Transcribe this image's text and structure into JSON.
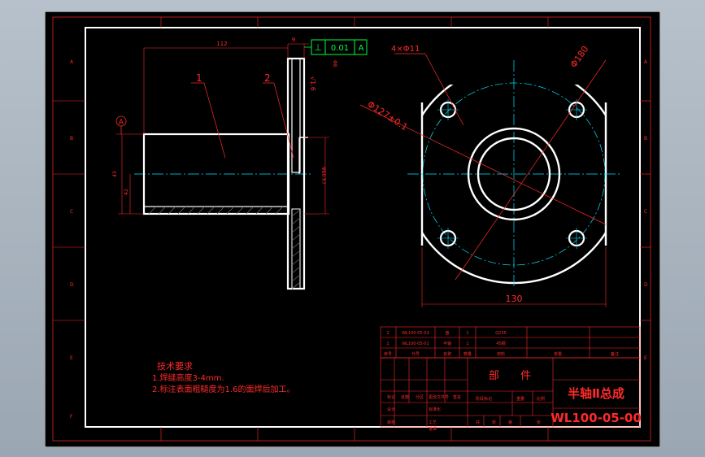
{
  "drawing": {
    "dimensions": {
      "length_112": "112",
      "thickness_9": "9",
      "tolerance_flatness_symbol": "⊥",
      "tolerance_value": "0.01",
      "tolerance_datum": "A",
      "datum_marker": "A",
      "holes": "4×Φ11",
      "outer_dia": "Φ180",
      "pcd": "Φ127±0.1",
      "width_130": "130",
      "left_dim_1": "43",
      "left_dim_2": "42",
      "shaft_dim": "Φ60 h7",
      "plate_dim": "Φ8"
    },
    "part_labels": [
      "1",
      "2"
    ],
    "zone_letters": [
      "A",
      "B",
      "C",
      "D",
      "E",
      "F"
    ],
    "zone_numbers": [
      "1",
      "2",
      "3",
      "4",
      "5",
      "6",
      "7",
      "8"
    ],
    "notes": {
      "title": "技术要求",
      "line1": "1.焊缝高度3-4mm.",
      "line2": "2.标注表面粗糙度为1.6的面焊后加工。"
    },
    "parts_list": {
      "rows": [
        [
          "2",
          "WL100-05-02",
          "盘",
          "1",
          "Q235",
          "",
          "",
          ""
        ],
        [
          "1",
          "WL100-05-01",
          "半轴",
          "1",
          "45钢",
          "",
          "",
          ""
        ]
      ],
      "header": [
        "序号",
        "代号",
        "名称",
        "数量",
        "材料",
        "单重",
        "总重",
        "备注"
      ]
    },
    "title_block": {
      "category": "部　　件",
      "name": "半轴Ⅱ总成",
      "code": "WL100-05-00",
      "labels": [
        "标记",
        "处数",
        "分区",
        "更改文件号",
        "签名",
        "年月日",
        "设计",
        "标准化",
        "阶段标记",
        "重量",
        "比例",
        "审核",
        "工艺",
        "批准",
        "共",
        "张",
        "第",
        "张"
      ]
    },
    "colors": {
      "background": "#000000",
      "frame": "#ffffff",
      "dimension": "#ff2a2a",
      "centerline": "#00e5ff",
      "tolerance": "#00ff40",
      "hatch": "#6a6a6a"
    }
  }
}
